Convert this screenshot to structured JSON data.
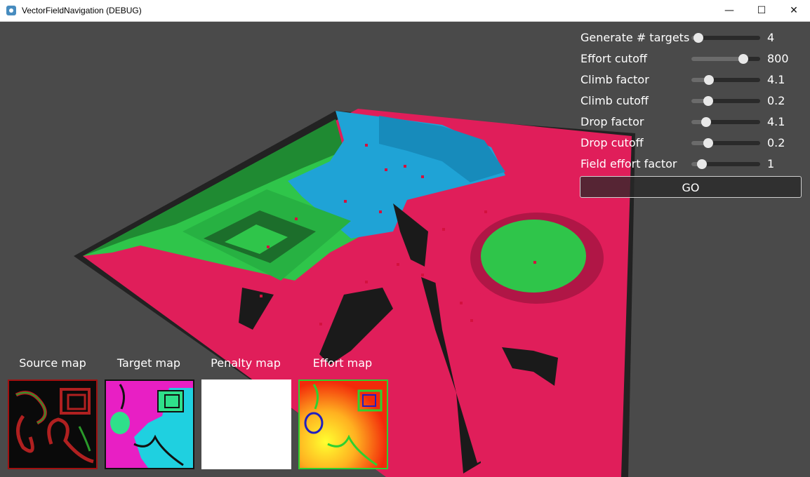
{
  "window": {
    "title": "VectorFieldNavigation (DEBUG)",
    "minimize_glyph": "—",
    "maximize_glyph": "☐",
    "close_glyph": "✕"
  },
  "settings": {
    "rows": [
      {
        "label": "Generate # targets",
        "value": "4",
        "level": 0.1
      },
      {
        "label": "Effort cutoff",
        "value": "800",
        "level": 0.76
      },
      {
        "label": "Climb factor",
        "value": "4.1",
        "level": 0.25
      },
      {
        "label": "Climb cutoff",
        "value": "0.2",
        "level": 0.24
      },
      {
        "label": "Drop factor",
        "value": "4.1",
        "level": 0.21
      },
      {
        "label": "Drop cutoff",
        "value": "0.2",
        "level": 0.24
      },
      {
        "label": "Field effort factor",
        "value": "1",
        "level": 0.15
      }
    ],
    "go_label": "GO"
  },
  "maps": {
    "source": "Source map",
    "target": "Target map",
    "penalty": "Penalty map",
    "effort": "Effort map"
  },
  "colors": {
    "floor": "#e01e5a",
    "green_zone": "#2fc54a",
    "blue_zone": "#1fa3d6",
    "background": "#4a4a4a"
  }
}
